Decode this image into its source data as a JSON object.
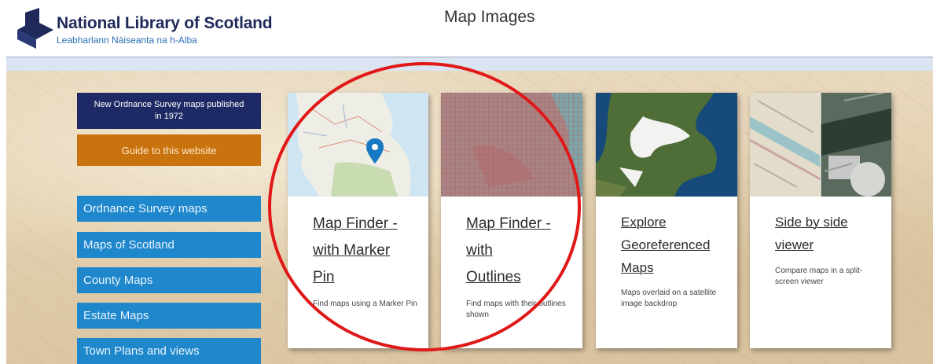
{
  "header": {
    "logo_title": "National Library of Scotland",
    "logo_subtitle": "Leabharlann Nàiseanta na h-Alba",
    "page_title": "Map Images"
  },
  "sidebar": {
    "notice": "New Ordnance Survey maps published in 1972",
    "guide_label": "Guide to this website",
    "nav_items": [
      {
        "label": "Ordnance Survey maps"
      },
      {
        "label": "Maps of Scotland"
      },
      {
        "label": "County Maps"
      },
      {
        "label": "Estate Maps"
      },
      {
        "label": "Town Plans and views"
      }
    ]
  },
  "cards": [
    {
      "title": "Map Finder - with Marker Pin",
      "title_lines": [
        "Map Finder -",
        "with Marker",
        "Pin"
      ],
      "desc": "Find maps using a Marker Pin"
    },
    {
      "title": "Map Finder - with Outlines",
      "title_lines": [
        "Map Finder -",
        "with",
        "Outlines"
      ],
      "desc": "Find maps with their outlines shown"
    },
    {
      "title": "Explore Georeferenced Maps",
      "title_lines": [
        "Explore",
        "Georeferenced",
        "Maps"
      ],
      "desc": "Maps overlaid on a satellite image backdrop"
    },
    {
      "title": "Side by side viewer",
      "title_lines": [
        "Side by side",
        "viewer"
      ],
      "desc": "Compare maps in a split-screen viewer"
    }
  ],
  "colors": {
    "brand_navy": "#1e2a66",
    "guide_orange": "#c9730e",
    "nav_blue": "#1f87cc",
    "annotation_red": "#e01818"
  },
  "icons": [
    "nls-logo-icon",
    "map-marker-pin-icon"
  ]
}
